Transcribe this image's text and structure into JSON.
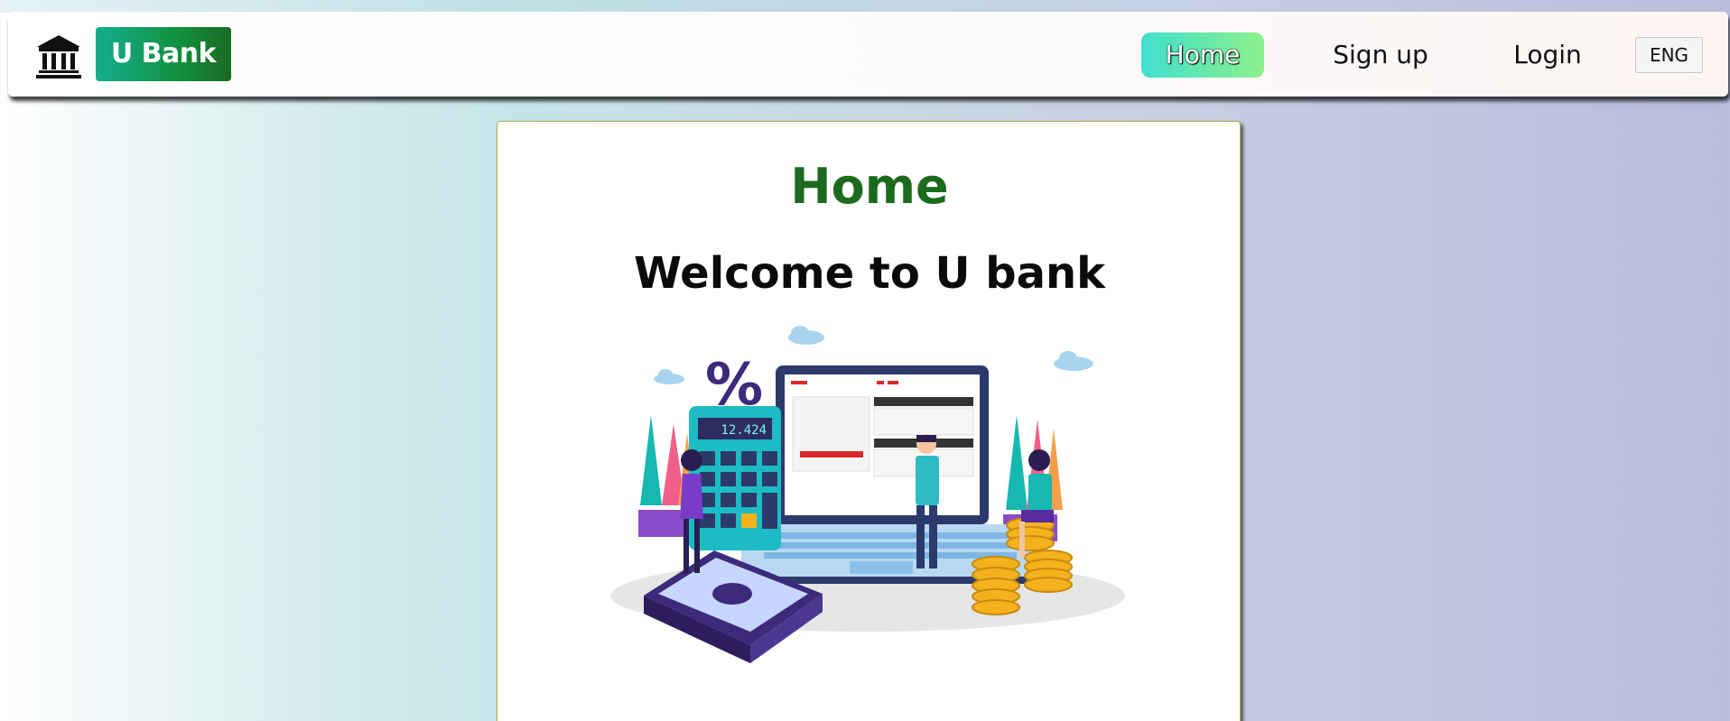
{
  "nav": {
    "brand": "U Bank",
    "links": [
      {
        "label": "Home",
        "active": true
      },
      {
        "label": "Sign up",
        "active": false
      },
      {
        "label": "Login",
        "active": false
      }
    ],
    "language": "ENG"
  },
  "main": {
    "title": "Home",
    "subtitle": "Welcome to U bank",
    "calculator_display": "12.424"
  },
  "colors": {
    "brand_start": "#13ae8e",
    "brand_end": "#1b6a22",
    "title_green": "#1b6a1e",
    "home_active_start": "#3fe0cf",
    "home_active_end": "#8ef08a"
  }
}
